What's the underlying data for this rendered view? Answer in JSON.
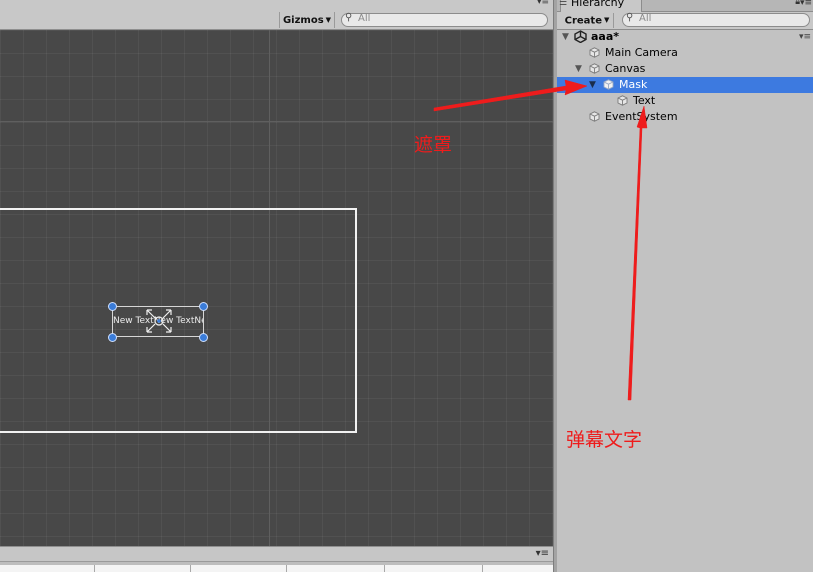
{
  "scene_view": {
    "gizmos_label": "Gizmos",
    "search_placeholder": "All",
    "search_icon": "search-icon",
    "text_preview": "New TextNew TextNe"
  },
  "hierarchy": {
    "tab_label": "Hierarchy",
    "create_label": "Create",
    "search_placeholder": "All",
    "scene_name": "aaa*",
    "items": [
      {
        "label": "Main Camera"
      },
      {
        "label": "Canvas"
      },
      {
        "label": "Mask"
      },
      {
        "label": "Text"
      },
      {
        "label": "EventSystem"
      }
    ]
  },
  "annotations": {
    "mask_label": "遮罩",
    "text_label": "弹幕文字",
    "color": "#ee1c1c"
  },
  "colors": {
    "selection": "#3d7ae0",
    "scene_background": "#484848",
    "panel_background": "#c2c2c2"
  }
}
